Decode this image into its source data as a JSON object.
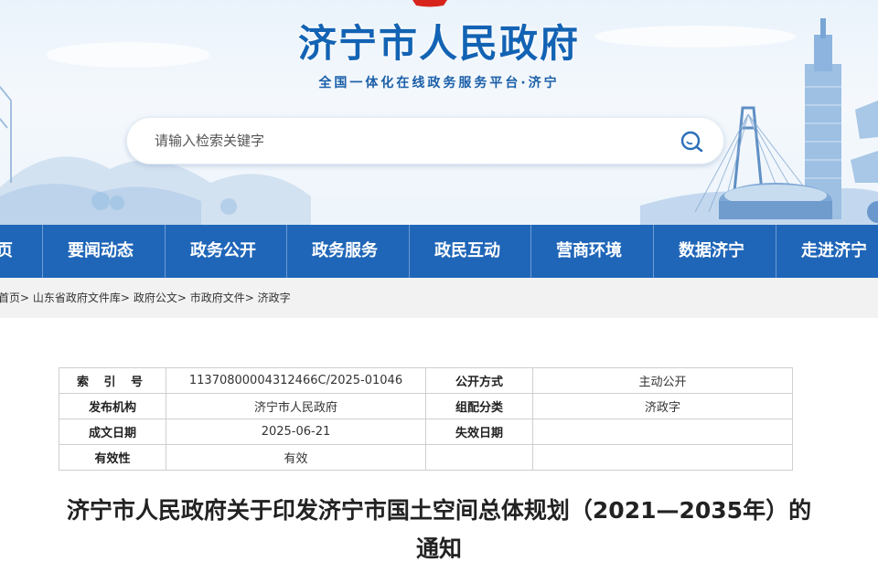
{
  "site": {
    "title": "济宁市人民政府",
    "slogan": "全国一体化在线政务服务平台·济宁"
  },
  "search": {
    "placeholder": "请输入检索关键字",
    "icon": "search-icon"
  },
  "nav": {
    "items": [
      "页",
      "要闻动态",
      "政务公开",
      "政务服务",
      "政民互动",
      "营商环境",
      "数据济宁",
      "走进济宁"
    ]
  },
  "breadcrumb": {
    "items": [
      "首页",
      "山东省政府文件库",
      "政府公文",
      "市政府文件",
      "济政字"
    ],
    "separator": ">"
  },
  "info_table": {
    "rows": [
      {
        "k1": "索 引 号",
        "v1": "11370800004312466C/2025-01046",
        "k2": "公开方式",
        "v2": "主动公开"
      },
      {
        "k1": "发布机构",
        "v1": "济宁市人民政府",
        "k2": "组配分类",
        "v2": "济政字"
      },
      {
        "k1": "成文日期",
        "v1": "2025-06-21",
        "k2": "失效日期",
        "v2": ""
      },
      {
        "k1": "有效性",
        "v1": "有效"
      }
    ]
  },
  "article": {
    "title_line1": "济宁市人民政府关于印发济宁市国土空间总体规划（2021—2035年）的",
    "title_line2": "通知"
  },
  "colors": {
    "brand_blue": "#1f66b8",
    "title_blue": "#1363b4",
    "breadcrumb_bg": "#f2f2f2"
  }
}
